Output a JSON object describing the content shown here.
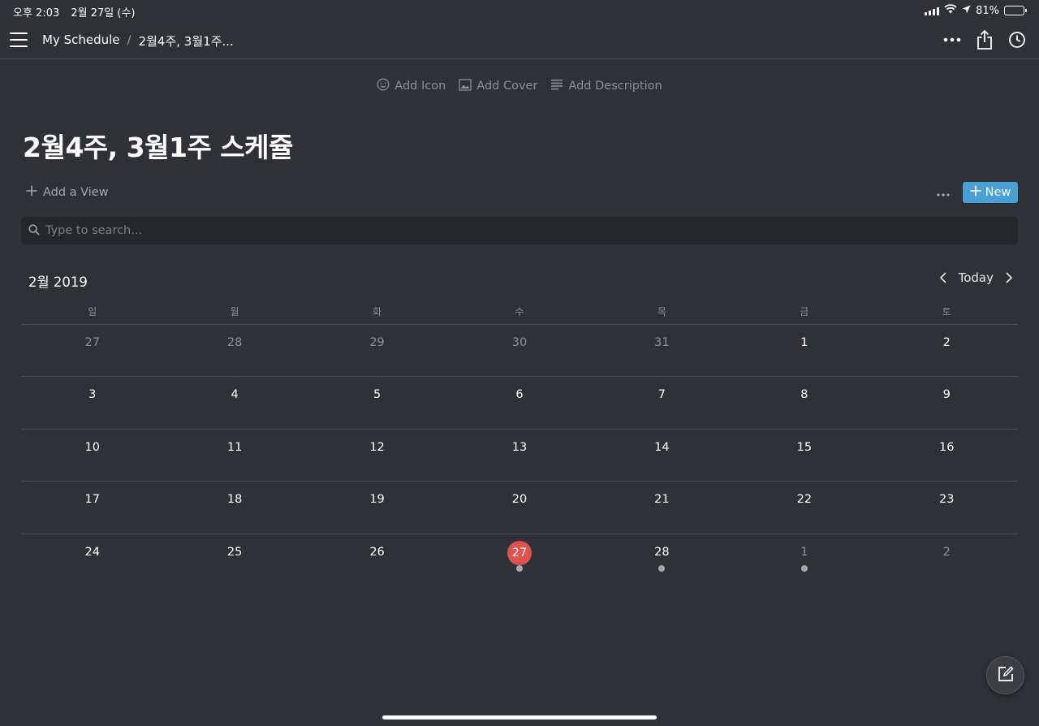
{
  "status": {
    "time": "오후 2:03",
    "date": "2월 27일 (수)",
    "battery": "81%",
    "battery_level": 0.81
  },
  "breadcrumb": {
    "workspace": "My Schedule",
    "separator": "/",
    "page": "2월4주, 3월1주..."
  },
  "page_actions": {
    "add_icon": "Add Icon",
    "add_cover": "Add Cover",
    "add_description": "Add Description"
  },
  "page": {
    "title": "2월4주, 3월1주 스케쥴"
  },
  "view": {
    "add_view": "Add a View",
    "new_label": "New"
  },
  "search": {
    "placeholder": "Type to search..."
  },
  "calendar": {
    "month_label": "2월 2019",
    "today_label": "Today",
    "weekdays": [
      "일",
      "월",
      "화",
      "수",
      "목",
      "금",
      "토"
    ],
    "weeks": [
      [
        {
          "day": "27",
          "outside": true
        },
        {
          "day": "28",
          "outside": true
        },
        {
          "day": "29",
          "outside": true
        },
        {
          "day": "30",
          "outside": true
        },
        {
          "day": "31",
          "outside": true
        },
        {
          "day": "1"
        },
        {
          "day": "2"
        }
      ],
      [
        {
          "day": "3"
        },
        {
          "day": "4"
        },
        {
          "day": "5"
        },
        {
          "day": "6"
        },
        {
          "day": "7"
        },
        {
          "day": "8"
        },
        {
          "day": "9"
        }
      ],
      [
        {
          "day": "10"
        },
        {
          "day": "11"
        },
        {
          "day": "12"
        },
        {
          "day": "13"
        },
        {
          "day": "14"
        },
        {
          "day": "15"
        },
        {
          "day": "16"
        }
      ],
      [
        {
          "day": "17"
        },
        {
          "day": "18"
        },
        {
          "day": "19"
        },
        {
          "day": "20"
        },
        {
          "day": "21"
        },
        {
          "day": "22"
        },
        {
          "day": "23"
        }
      ],
      [
        {
          "day": "24"
        },
        {
          "day": "25"
        },
        {
          "day": "26"
        },
        {
          "day": "27",
          "today": true,
          "event": true
        },
        {
          "day": "28",
          "event": true
        },
        {
          "day": "1",
          "outside": true,
          "event": true
        },
        {
          "day": "2",
          "outside": true
        }
      ]
    ]
  },
  "colors": {
    "background": "#2f3136",
    "accent_blue": "#4a9fd4",
    "today_red": "#e0524f"
  }
}
